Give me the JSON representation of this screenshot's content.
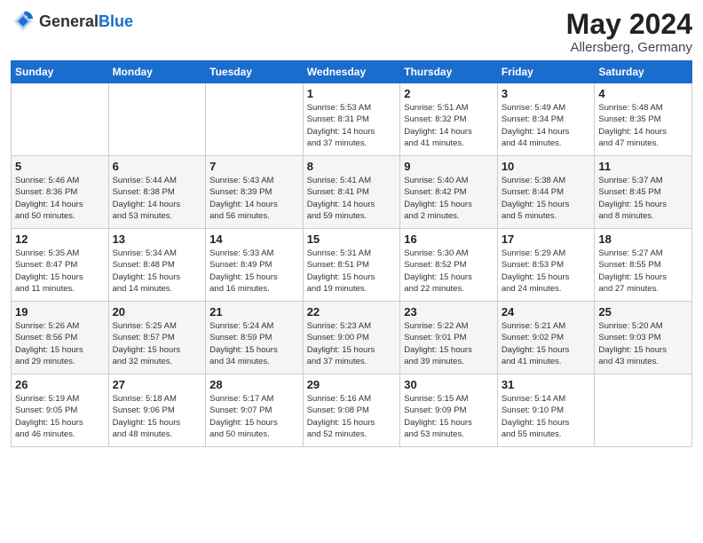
{
  "header": {
    "logo_general": "General",
    "logo_blue": "Blue",
    "title": "May 2024",
    "subtitle": "Allersberg, Germany"
  },
  "weekdays": [
    "Sunday",
    "Monday",
    "Tuesday",
    "Wednesday",
    "Thursday",
    "Friday",
    "Saturday"
  ],
  "weeks": [
    [
      {
        "day": "",
        "info": ""
      },
      {
        "day": "",
        "info": ""
      },
      {
        "day": "",
        "info": ""
      },
      {
        "day": "1",
        "info": "Sunrise: 5:53 AM\nSunset: 8:31 PM\nDaylight: 14 hours\nand 37 minutes."
      },
      {
        "day": "2",
        "info": "Sunrise: 5:51 AM\nSunset: 8:32 PM\nDaylight: 14 hours\nand 41 minutes."
      },
      {
        "day": "3",
        "info": "Sunrise: 5:49 AM\nSunset: 8:34 PM\nDaylight: 14 hours\nand 44 minutes."
      },
      {
        "day": "4",
        "info": "Sunrise: 5:48 AM\nSunset: 8:35 PM\nDaylight: 14 hours\nand 47 minutes."
      }
    ],
    [
      {
        "day": "5",
        "info": "Sunrise: 5:46 AM\nSunset: 8:36 PM\nDaylight: 14 hours\nand 50 minutes."
      },
      {
        "day": "6",
        "info": "Sunrise: 5:44 AM\nSunset: 8:38 PM\nDaylight: 14 hours\nand 53 minutes."
      },
      {
        "day": "7",
        "info": "Sunrise: 5:43 AM\nSunset: 8:39 PM\nDaylight: 14 hours\nand 56 minutes."
      },
      {
        "day": "8",
        "info": "Sunrise: 5:41 AM\nSunset: 8:41 PM\nDaylight: 14 hours\nand 59 minutes."
      },
      {
        "day": "9",
        "info": "Sunrise: 5:40 AM\nSunset: 8:42 PM\nDaylight: 15 hours\nand 2 minutes."
      },
      {
        "day": "10",
        "info": "Sunrise: 5:38 AM\nSunset: 8:44 PM\nDaylight: 15 hours\nand 5 minutes."
      },
      {
        "day": "11",
        "info": "Sunrise: 5:37 AM\nSunset: 8:45 PM\nDaylight: 15 hours\nand 8 minutes."
      }
    ],
    [
      {
        "day": "12",
        "info": "Sunrise: 5:35 AM\nSunset: 8:47 PM\nDaylight: 15 hours\nand 11 minutes."
      },
      {
        "day": "13",
        "info": "Sunrise: 5:34 AM\nSunset: 8:48 PM\nDaylight: 15 hours\nand 14 minutes."
      },
      {
        "day": "14",
        "info": "Sunrise: 5:33 AM\nSunset: 8:49 PM\nDaylight: 15 hours\nand 16 minutes."
      },
      {
        "day": "15",
        "info": "Sunrise: 5:31 AM\nSunset: 8:51 PM\nDaylight: 15 hours\nand 19 minutes."
      },
      {
        "day": "16",
        "info": "Sunrise: 5:30 AM\nSunset: 8:52 PM\nDaylight: 15 hours\nand 22 minutes."
      },
      {
        "day": "17",
        "info": "Sunrise: 5:29 AM\nSunset: 8:53 PM\nDaylight: 15 hours\nand 24 minutes."
      },
      {
        "day": "18",
        "info": "Sunrise: 5:27 AM\nSunset: 8:55 PM\nDaylight: 15 hours\nand 27 minutes."
      }
    ],
    [
      {
        "day": "19",
        "info": "Sunrise: 5:26 AM\nSunset: 8:56 PM\nDaylight: 15 hours\nand 29 minutes."
      },
      {
        "day": "20",
        "info": "Sunrise: 5:25 AM\nSunset: 8:57 PM\nDaylight: 15 hours\nand 32 minutes."
      },
      {
        "day": "21",
        "info": "Sunrise: 5:24 AM\nSunset: 8:59 PM\nDaylight: 15 hours\nand 34 minutes."
      },
      {
        "day": "22",
        "info": "Sunrise: 5:23 AM\nSunset: 9:00 PM\nDaylight: 15 hours\nand 37 minutes."
      },
      {
        "day": "23",
        "info": "Sunrise: 5:22 AM\nSunset: 9:01 PM\nDaylight: 15 hours\nand 39 minutes."
      },
      {
        "day": "24",
        "info": "Sunrise: 5:21 AM\nSunset: 9:02 PM\nDaylight: 15 hours\nand 41 minutes."
      },
      {
        "day": "25",
        "info": "Sunrise: 5:20 AM\nSunset: 9:03 PM\nDaylight: 15 hours\nand 43 minutes."
      }
    ],
    [
      {
        "day": "26",
        "info": "Sunrise: 5:19 AM\nSunset: 9:05 PM\nDaylight: 15 hours\nand 46 minutes."
      },
      {
        "day": "27",
        "info": "Sunrise: 5:18 AM\nSunset: 9:06 PM\nDaylight: 15 hours\nand 48 minutes."
      },
      {
        "day": "28",
        "info": "Sunrise: 5:17 AM\nSunset: 9:07 PM\nDaylight: 15 hours\nand 50 minutes."
      },
      {
        "day": "29",
        "info": "Sunrise: 5:16 AM\nSunset: 9:08 PM\nDaylight: 15 hours\nand 52 minutes."
      },
      {
        "day": "30",
        "info": "Sunrise: 5:15 AM\nSunset: 9:09 PM\nDaylight: 15 hours\nand 53 minutes."
      },
      {
        "day": "31",
        "info": "Sunrise: 5:14 AM\nSunset: 9:10 PM\nDaylight: 15 hours\nand 55 minutes."
      },
      {
        "day": "",
        "info": ""
      }
    ]
  ]
}
